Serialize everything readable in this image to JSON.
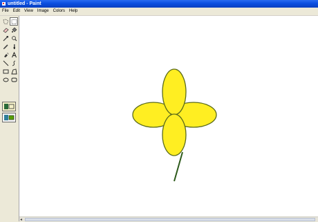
{
  "window": {
    "title": "untitled - Paint",
    "title_bar_color": "#0b4ee0"
  },
  "menu": {
    "items": [
      "File",
      "Edit",
      "View",
      "Image",
      "Colors",
      "Help"
    ]
  },
  "toolbox": {
    "tools": [
      {
        "name": "free-select-icon",
        "selected": false
      },
      {
        "name": "rect-select-icon",
        "selected": true
      },
      {
        "name": "eraser-icon",
        "selected": false
      },
      {
        "name": "fill-bucket-icon",
        "selected": false
      },
      {
        "name": "color-picker-icon",
        "selected": false
      },
      {
        "name": "magnifier-icon",
        "selected": false
      },
      {
        "name": "pencil-icon",
        "selected": false
      },
      {
        "name": "brush-icon",
        "selected": false
      },
      {
        "name": "airbrush-icon",
        "selected": false
      },
      {
        "name": "text-icon",
        "selected": false
      },
      {
        "name": "line-icon",
        "selected": false
      },
      {
        "name": "curve-icon",
        "selected": false
      },
      {
        "name": "rectangle-icon",
        "selected": false
      },
      {
        "name": "polygon-icon",
        "selected": false
      },
      {
        "name": "ellipse-icon",
        "selected": false
      },
      {
        "name": "rounded-rect-icon",
        "selected": false
      }
    ]
  },
  "canvas": {
    "background": "#ffffff",
    "drawing": {
      "petal_fill": "#ffee22",
      "petal_stroke": "#5a6a1a",
      "stem_color": "#2d5a1b"
    }
  }
}
